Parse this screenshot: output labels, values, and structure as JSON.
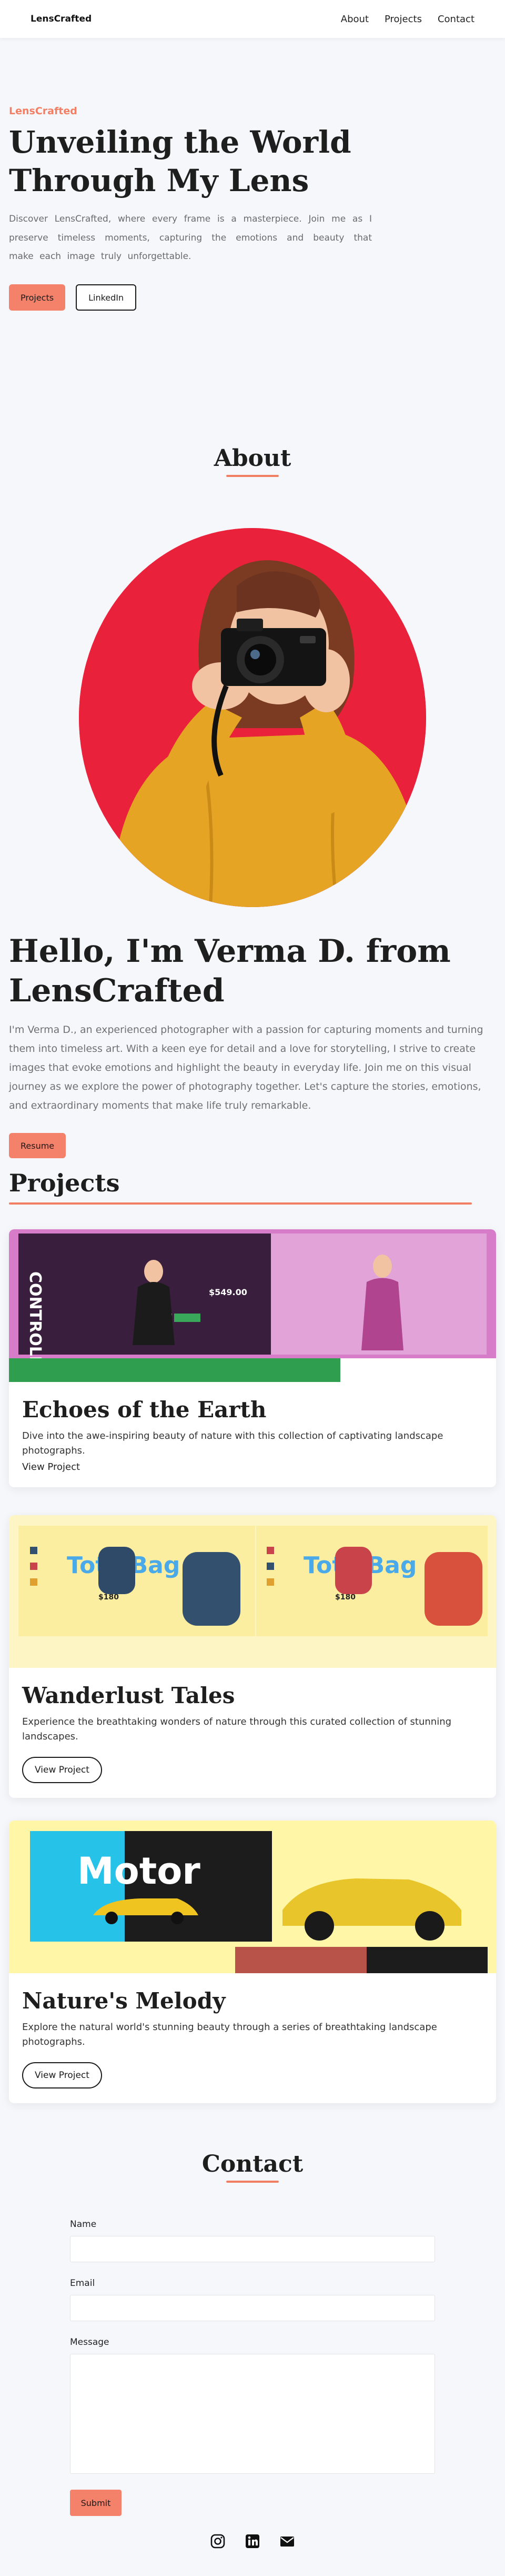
{
  "nav": {
    "brand": "LensCrafted",
    "links": [
      "About",
      "Projects",
      "Contact"
    ]
  },
  "hero": {
    "eyebrow": "LensCrafted",
    "title": "Unveiling the World Through My Lens",
    "text": "Discover LensCrafted, where every frame is a masterpiece. Join me as I preserve timeless moments, capturing the emotions and beauty that make each image truly unforgettable.",
    "primary_button": "Projects",
    "secondary_button": "LinkedIn"
  },
  "about": {
    "section_title": "About",
    "heading": "Hello, I'm Verma D. from LensCrafted",
    "text": "I'm Verma D., an experienced photographer with a passion for capturing moments and turning them into timeless art. With a keen eye for detail and a love for storytelling, I strive to create images that evoke emotions and highlight the beauty in everyday life. Join me on this visual journey as we explore the power of photography together. Let's capture the stories, emotions, and extraordinary moments that make life truly remarkable.",
    "resume_button": "Resume"
  },
  "projects": {
    "section_title": "Projects",
    "items": [
      {
        "title": "Echoes of the Earth",
        "description": "Dive into the awe-inspiring beauty of nature with this collection of captivating landscape photographs.",
        "link": "View Project",
        "thumb_word": "CONTROLLED",
        "thumb_price": "$549.00"
      },
      {
        "title": "Wanderlust Tales",
        "description": "Experience the breathtaking wonders of nature through this curated collection of stunning landscapes.",
        "link": "View Project",
        "thumb_word": "Tote Bag",
        "thumb_price": "$180"
      },
      {
        "title": "Nature's Melody",
        "description": "Explore the natural world's stunning beauty through a series of breathtaking landscape photographs.",
        "link": "View Project",
        "thumb_word": "Motor"
      }
    ]
  },
  "contact": {
    "section_title": "Contact",
    "name_label": "Name",
    "email_label": "Email",
    "message_label": "Message",
    "submit": "Submit"
  },
  "colors": {
    "accent": "#f27f63",
    "background": "#f6f7fb",
    "portrait_bg": "#e9213a"
  },
  "socials": [
    "instagram-icon",
    "linkedin-icon",
    "mail-icon"
  ]
}
